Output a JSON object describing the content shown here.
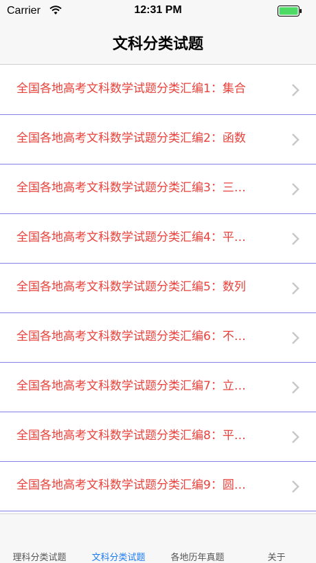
{
  "status_bar": {
    "carrier": "Carrier",
    "time": "12:31 PM",
    "battery_color": "#4cd964"
  },
  "nav": {
    "title": "文科分类试题"
  },
  "list": {
    "items": [
      {
        "label": "全国各地高考文科数学试题分类汇编1：集合"
      },
      {
        "label": "全国各地高考文科数学试题分类汇编2：函数"
      },
      {
        "label": "全国各地高考文科数学试题分类汇编3：三…"
      },
      {
        "label": "全国各地高考文科数学试题分类汇编4：平…"
      },
      {
        "label": "全国各地高考文科数学试题分类汇编5：数列"
      },
      {
        "label": "全国各地高考文科数学试题分类汇编6：不…"
      },
      {
        "label": "全国各地高考文科数学试题分类汇编7：立…"
      },
      {
        "label": "全国各地高考文科数学试题分类汇编8：平…"
      },
      {
        "label": "全国各地高考文科数学试题分类汇编9：圆…"
      }
    ],
    "text_color": "#e8413b",
    "separator_color": "#8080e6",
    "accessory_icon": "chevron-right-icon"
  },
  "tab_bar": {
    "tabs": [
      {
        "label": "理科分类试题"
      },
      {
        "label": "文科分类试题"
      },
      {
        "label": "各地历年真题"
      },
      {
        "label": "关于"
      }
    ],
    "selected": "文科分类试题",
    "active_color": "#1e7cf2"
  }
}
